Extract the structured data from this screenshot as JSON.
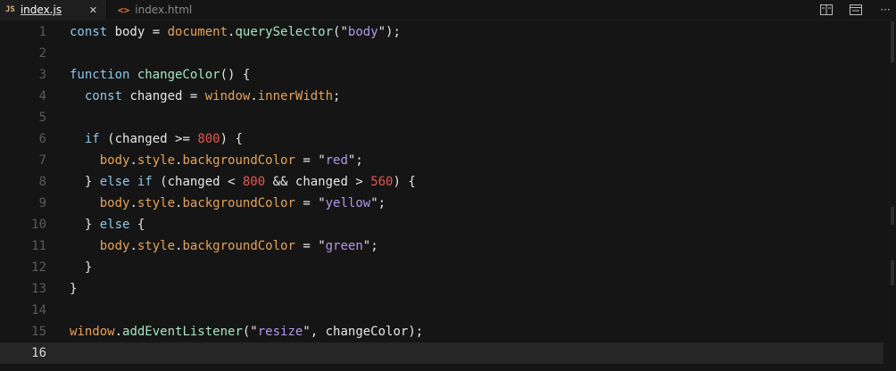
{
  "tabs": [
    {
      "name": "index.js",
      "icon": "JS",
      "close": "✕",
      "active": true
    },
    {
      "name": "index.html",
      "icon": "<>",
      "active": false
    }
  ],
  "toolbar": {
    "more": "···"
  },
  "editor": {
    "lines": [
      {
        "n": "1",
        "tokens": [
          [
            "kw",
            "const "
          ],
          [
            "pl",
            "body "
          ],
          [
            "pl",
            "= "
          ],
          [
            "obj",
            "document"
          ],
          [
            "pl",
            "."
          ],
          [
            "fn",
            "querySelector"
          ],
          [
            "pl",
            "(\""
          ],
          [
            "str",
            "body"
          ],
          [
            "pl",
            "\");"
          ]
        ]
      },
      {
        "n": "2",
        "tokens": []
      },
      {
        "n": "3",
        "tokens": [
          [
            "kw",
            "function "
          ],
          [
            "fn",
            "changeColor"
          ],
          [
            "pl",
            "() {"
          ]
        ]
      },
      {
        "n": "4",
        "tokens": [
          [
            "pl",
            "  "
          ],
          [
            "kw",
            "const "
          ],
          [
            "pl",
            "changed "
          ],
          [
            "pl",
            "= "
          ],
          [
            "obj",
            "window"
          ],
          [
            "pl",
            "."
          ],
          [
            "obj",
            "innerWidth"
          ],
          [
            "pl",
            ";"
          ]
        ]
      },
      {
        "n": "5",
        "tokens": []
      },
      {
        "n": "6",
        "tokens": [
          [
            "pl",
            "  "
          ],
          [
            "kw",
            "if "
          ],
          [
            "pl",
            "(changed >= "
          ],
          [
            "num",
            "800"
          ],
          [
            "pl",
            ") {"
          ]
        ]
      },
      {
        "n": "7",
        "tokens": [
          [
            "pl",
            "    "
          ],
          [
            "obj",
            "body"
          ],
          [
            "pl",
            "."
          ],
          [
            "obj",
            "style"
          ],
          [
            "pl",
            "."
          ],
          [
            "obj",
            "backgroundColor"
          ],
          [
            "pl",
            " = \""
          ],
          [
            "str",
            "red"
          ],
          [
            "pl",
            "\";"
          ]
        ]
      },
      {
        "n": "8",
        "tokens": [
          [
            "pl",
            "  } "
          ],
          [
            "kw",
            "else if "
          ],
          [
            "pl",
            "(changed < "
          ],
          [
            "num",
            "800"
          ],
          [
            "pl",
            " && changed > "
          ],
          [
            "num",
            "560"
          ],
          [
            "pl",
            ") {"
          ]
        ]
      },
      {
        "n": "9",
        "tokens": [
          [
            "pl",
            "    "
          ],
          [
            "obj",
            "body"
          ],
          [
            "pl",
            "."
          ],
          [
            "obj",
            "style"
          ],
          [
            "pl",
            "."
          ],
          [
            "obj",
            "backgroundColor"
          ],
          [
            "pl",
            " = \""
          ],
          [
            "str",
            "yellow"
          ],
          [
            "pl",
            "\";"
          ]
        ]
      },
      {
        "n": "10",
        "tokens": [
          [
            "pl",
            "  } "
          ],
          [
            "kw",
            "else "
          ],
          [
            "pl",
            "{"
          ]
        ]
      },
      {
        "n": "11",
        "tokens": [
          [
            "pl",
            "    "
          ],
          [
            "obj",
            "body"
          ],
          [
            "pl",
            "."
          ],
          [
            "obj",
            "style"
          ],
          [
            "pl",
            "."
          ],
          [
            "obj",
            "backgroundColor"
          ],
          [
            "pl",
            " = \""
          ],
          [
            "str",
            "green"
          ],
          [
            "pl",
            "\";"
          ]
        ]
      },
      {
        "n": "12",
        "tokens": [
          [
            "pl",
            "  }"
          ]
        ]
      },
      {
        "n": "13",
        "tokens": [
          [
            "pl",
            "}"
          ]
        ]
      },
      {
        "n": "14",
        "tokens": []
      },
      {
        "n": "15",
        "tokens": [
          [
            "obj",
            "window"
          ],
          [
            "pl",
            "."
          ],
          [
            "fn",
            "addEventListener"
          ],
          [
            "pl",
            "(\""
          ],
          [
            "str",
            "resize"
          ],
          [
            "pl",
            "\", "
          ],
          [
            "pl",
            "changeColor"
          ],
          [
            "pl",
            ");"
          ]
        ]
      },
      {
        "n": "16",
        "tokens": [],
        "current": true
      }
    ]
  }
}
